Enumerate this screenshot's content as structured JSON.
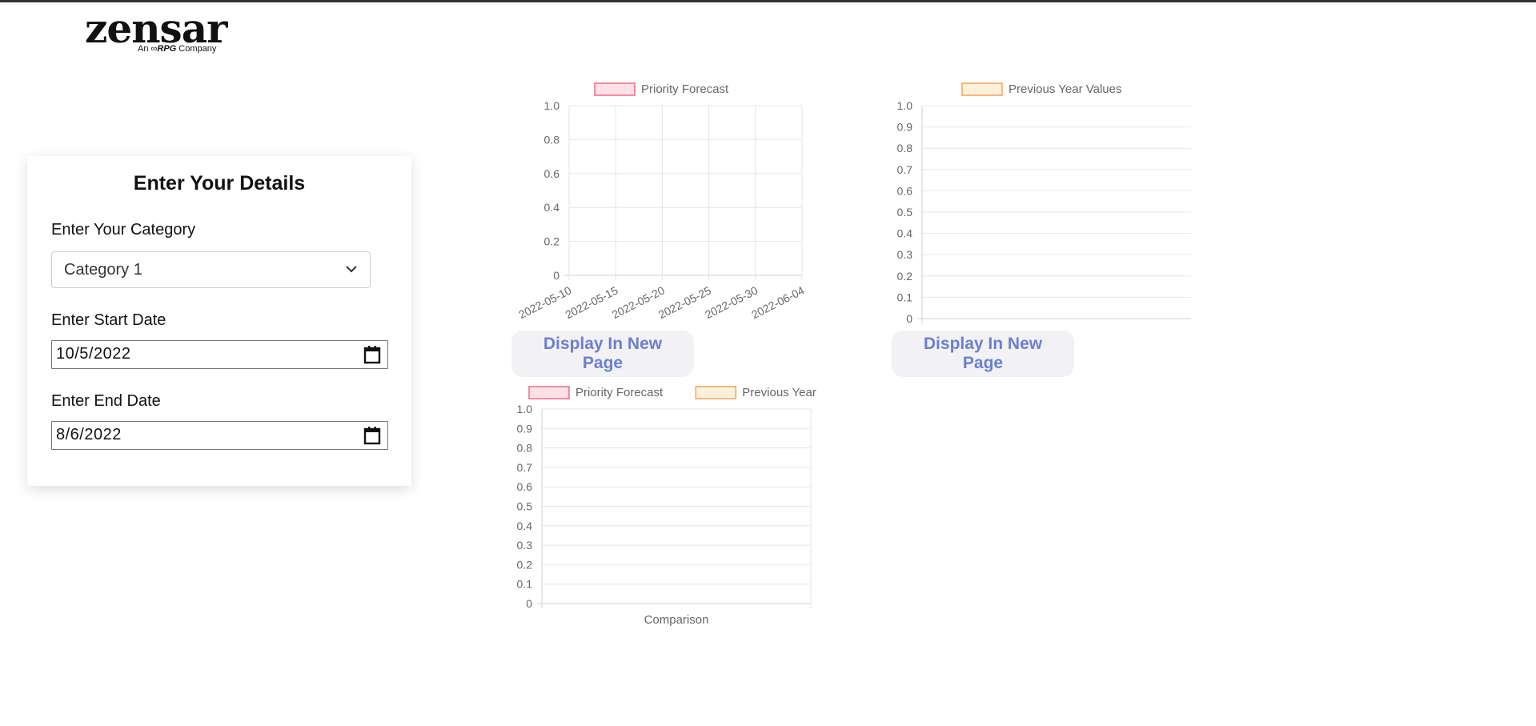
{
  "logo": {
    "wordmark": "zensar",
    "tagline_prefix": "An",
    "tagline_brand": "RPG",
    "tagline_suffix": "Company"
  },
  "form": {
    "title": "Enter Your Details",
    "category_label": "Enter Your Category",
    "category_value": "Category 1",
    "start_label": "Enter Start Date",
    "start_value": "10/5/2022",
    "end_label": "Enter End Date",
    "end_value": "8/6/2022"
  },
  "buttons": {
    "display_new_page_1": "Display In New Page",
    "display_new_page_2": "Display In New Page"
  },
  "colors": {
    "priority_fill": "#ffe1e6",
    "priority_border": "#f06a86",
    "previous_fill": "#fff0dc",
    "previous_border": "#f5a35a",
    "grid": "#e5e5e5",
    "tick_text": "#666666"
  },
  "chart_data": [
    {
      "type": "line",
      "legend": [
        "Priority Forecast"
      ],
      "series": [
        {
          "name": "Priority Forecast",
          "values": []
        }
      ],
      "x_ticks": [
        "2022-05-10",
        "2022-05-15",
        "2022-05-20",
        "2022-05-25",
        "2022-05-30",
        "2022-06-04"
      ],
      "y_ticks": [
        "0",
        "0.2",
        "0.4",
        "0.6",
        "0.8",
        "1.0"
      ],
      "ylim": [
        0,
        1
      ],
      "grid": true,
      "legend_position": "top"
    },
    {
      "type": "line",
      "legend": [
        "Previous Year Values"
      ],
      "series": [
        {
          "name": "Previous Year Values",
          "values": []
        }
      ],
      "x_ticks": [],
      "y_ticks": [
        "0",
        "0.1",
        "0.2",
        "0.3",
        "0.4",
        "0.5",
        "0.6",
        "0.7",
        "0.8",
        "0.9",
        "1.0"
      ],
      "ylim": [
        0,
        1
      ],
      "grid": true,
      "legend_position": "top"
    },
    {
      "type": "bar",
      "legend": [
        "Priority Forecast",
        "Previous Year"
      ],
      "categories": [],
      "series": [
        {
          "name": "Priority Forecast",
          "values": []
        },
        {
          "name": "Previous Year",
          "values": []
        }
      ],
      "xlabel": "Comparison",
      "y_ticks": [
        "0",
        "0.1",
        "0.2",
        "0.3",
        "0.4",
        "0.5",
        "0.6",
        "0.7",
        "0.8",
        "0.9",
        "1.0"
      ],
      "ylim": [
        0,
        1
      ],
      "grid": true,
      "legend_position": "top"
    }
  ]
}
